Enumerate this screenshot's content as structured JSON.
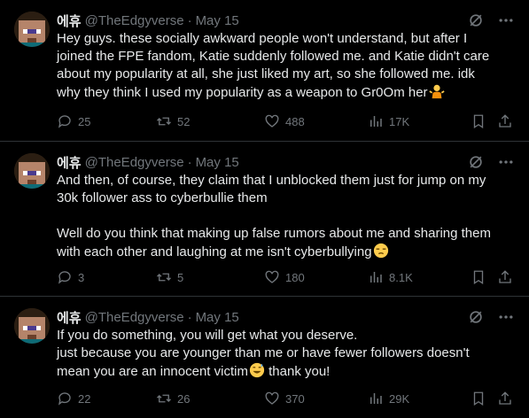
{
  "tweets": [
    {
      "name": "에휴",
      "handle": "@TheEdgyverse",
      "dot": "·",
      "time": "May 15",
      "lines": [
        "Hey guys. these socially awkward people won't understand, but after I",
        "joined the FPE fandom, Katie suddenly followed me. and Katie didn't care",
        "about my popularity at all, she just liked my art, so she followed me. idk",
        "why they think I used my popularity as a weapon to Gr0Om her"
      ],
      "emoji": "person-shrugging-emoji",
      "replies": "25",
      "retweets": "52",
      "likes": "488",
      "views": "17K"
    },
    {
      "name": "에휴",
      "handle": "@TheEdgyverse",
      "dot": "·",
      "time": "May 15",
      "lines": [
        "And then, of course, they claim that I unblocked them just for jump on my",
        "30k follower ass to cyberbullie them",
        "",
        "Well do you think that making up false rumors about me and sharing them",
        "with each other and laughing at me isn't cyberbullying"
      ],
      "emoji": "unamused-face-emoji",
      "replies": "3",
      "retweets": "5",
      "likes": "180",
      "views": "8.1K"
    },
    {
      "name": "에휴",
      "handle": "@TheEdgyverse",
      "dot": "·",
      "time": "May 15",
      "lines": [
        "If you do something, you will get what you deserve.",
        "just because you are younger than me or have fewer followers doesn't",
        "mean you are an innocent victim",
        " thank you!"
      ],
      "emoji": "grinning-sweat-face-emoji",
      "replies": "22",
      "retweets": "26",
      "likes": "370",
      "views": "29K"
    }
  ],
  "colors": {
    "background": "#000000",
    "text": "#e7e9ea",
    "muted": "#71767b",
    "divider": "#2f3336"
  }
}
